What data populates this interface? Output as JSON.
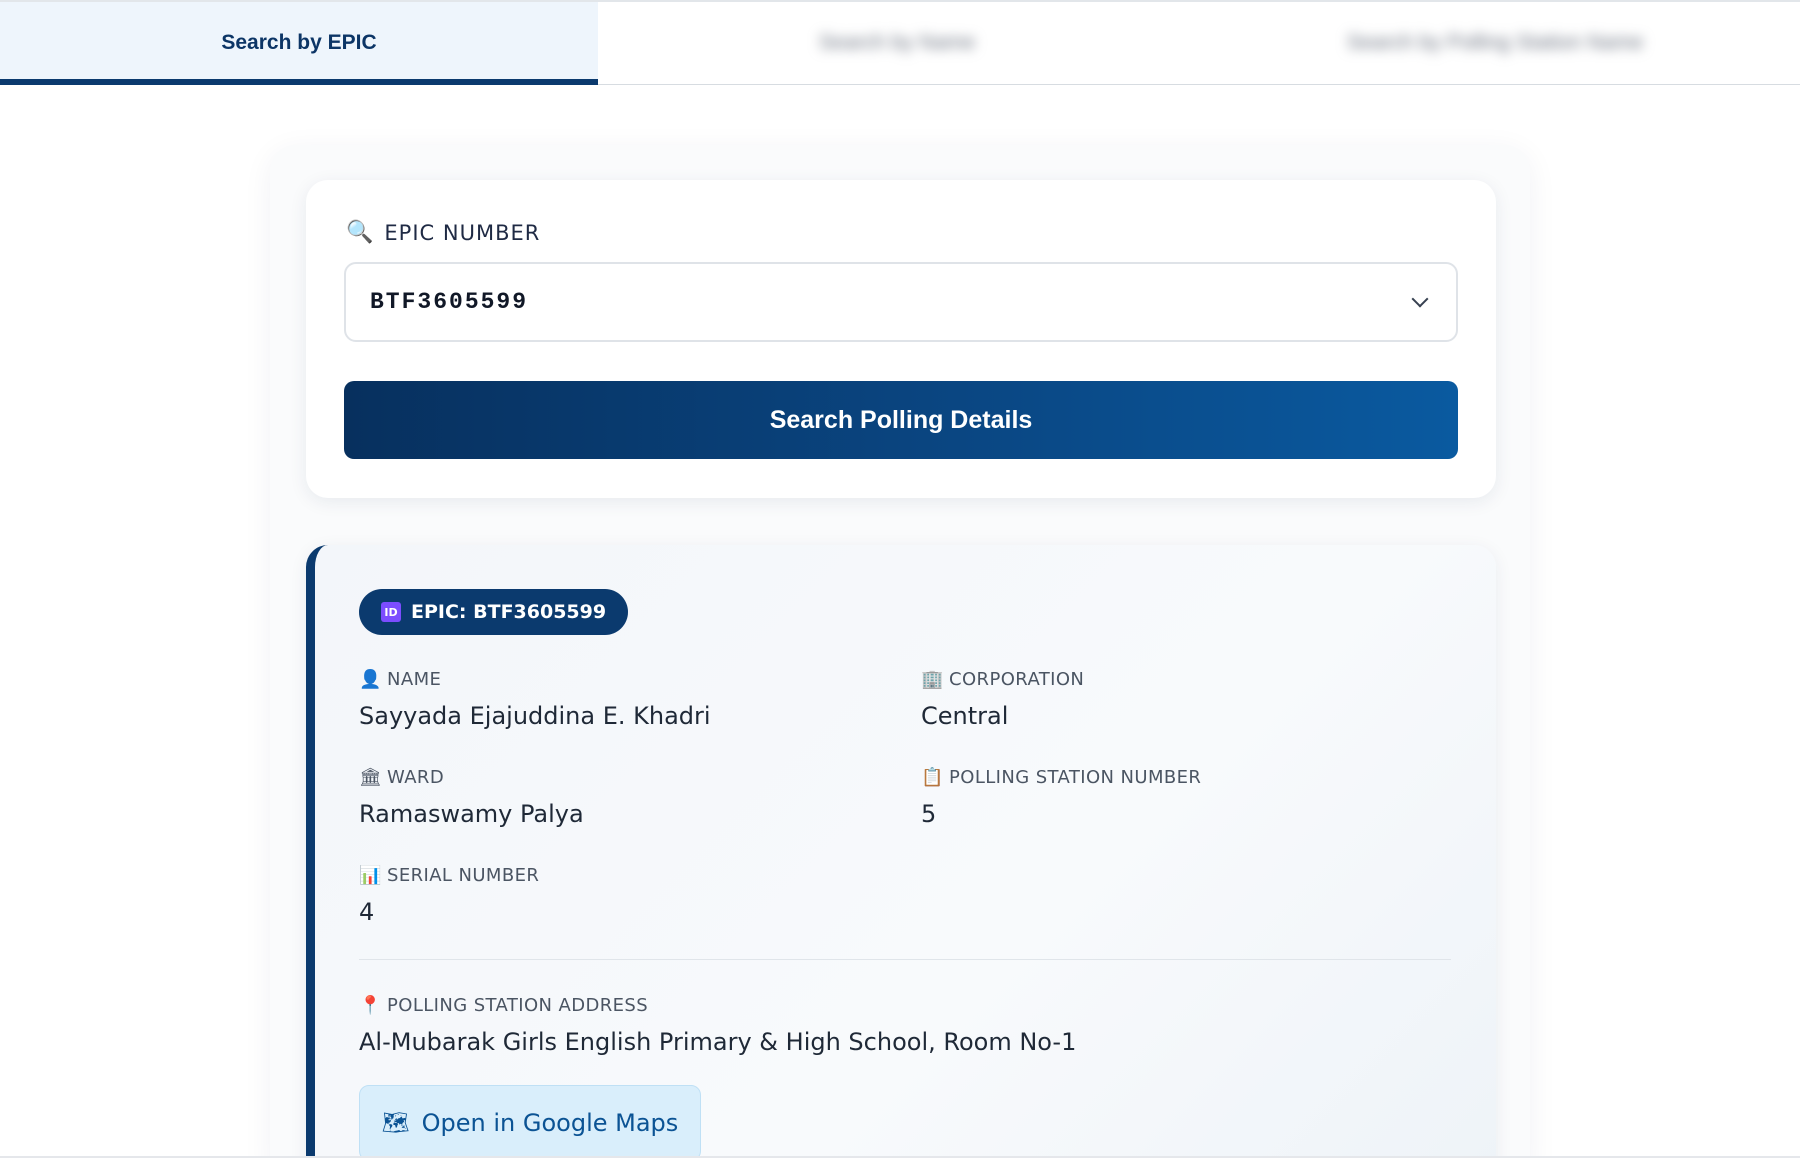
{
  "tabs": [
    {
      "label": "Search by EPIC",
      "active": true
    },
    {
      "label": "Search by Name",
      "active": false
    },
    {
      "label": "Search by Polling Station Name",
      "active": false
    }
  ],
  "search": {
    "field_label": "EPIC NUMBER",
    "selected_value": "BTF3605599",
    "button_label": "Search Polling Details"
  },
  "result": {
    "badge": "EPIC: BTF3605599",
    "name_label": "NAME",
    "name_value": "Sayyada Ejajuddina E. Khadri",
    "corporation_label": "CORPORATION",
    "corporation_value": "Central",
    "ward_label": "WARD",
    "ward_value": "Ramaswamy Palya",
    "ps_number_label": "POLLING STATION NUMBER",
    "ps_number_value": "5",
    "serial_label": "SERIAL NUMBER",
    "serial_value": "4",
    "address_label": "POLLING STATION ADDRESS",
    "address_value": "Al-Mubarak Girls English Primary & High School, Room No-1",
    "maps_button_label": "Open in Google Maps"
  },
  "icons": {
    "search": "magnifier-icon",
    "id": "id-card-icon",
    "name": "person-icon",
    "corporation": "office-building-icon",
    "ward": "classical-building-icon",
    "ps_number": "clipboard-icon",
    "serial": "bar-chart-icon",
    "address": "pin-icon",
    "maps": "map-icon"
  },
  "colors": {
    "primary": "#0b3a6e",
    "active_tab_bg": "#eef5fc",
    "maps_button_bg": "#d9eefb"
  }
}
